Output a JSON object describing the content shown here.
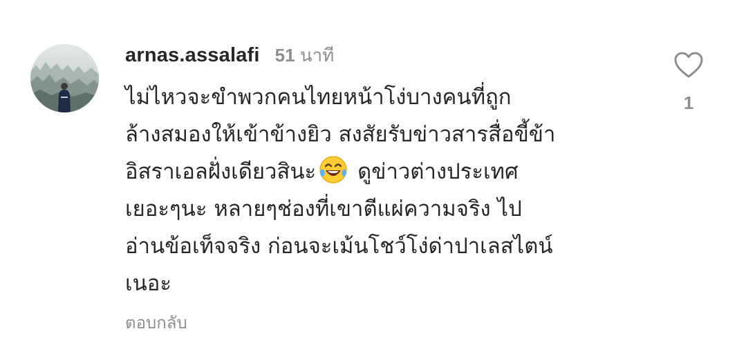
{
  "comment": {
    "username": "arnas.assalafi",
    "time_value": "51",
    "time_unit": "นาที",
    "text_lines": [
      "ไม่ไหวจะขำพวกคนไทยหน้าโง่บางคนที่ถูก",
      "ล้างสมองให้เข้าข้างยิว สงสัยรับข่าวสารสื่อขี้ข้า",
      "อิสราเอลฝั่งเดียวสินะ",
      "ดูข่าวต่างประเทศ",
      "เยอะๆนะ หลายๆช่องที่เขาตีแผ่ความจริง  ไป",
      "อ่านข้อเท็จจริง ก่อนจะเม้นโชว์โง่ด่าปาเลสไตน์",
      "เนอะ"
    ],
    "emoji_icon": "face-with-tears-of-joy-emoji",
    "reply_label": "ตอบกลับ",
    "like_icon": "heart-outline-icon",
    "like_count": "1",
    "avatar_icon": "avatar-misty-forest-person"
  }
}
